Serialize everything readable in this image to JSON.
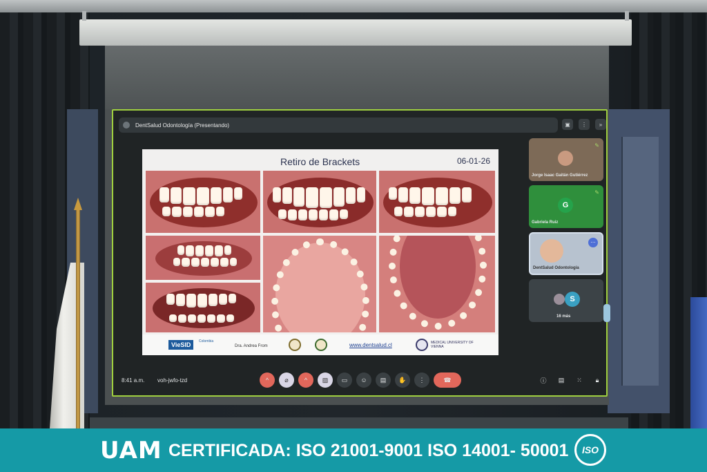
{
  "meeting": {
    "presenter_label": "DentSalud Odontología (Presentando)",
    "time": "8:41 a.m.",
    "meeting_code": "voh-jwfo-tzd",
    "participants": [
      {
        "name": "Jorge Isaac Gaitán Gutiérrez",
        "avatar": "photo"
      },
      {
        "name": "Gabriela Ruiz",
        "avatar": "G"
      },
      {
        "name": "DentSalud Odontología",
        "avatar": "photo"
      },
      {
        "name": "16 más",
        "avatar": "S"
      }
    ]
  },
  "slide": {
    "title": "Retiro de Brackets",
    "date": "06-01-26",
    "logo_viesid": "VieSID",
    "logo_viesid_sub": "Colombia",
    "author": "Dra. Andrea From",
    "website": "www.dentsalud.cl",
    "university": "MEDICAL UNIVERSITY OF VIENNA"
  },
  "banner": {
    "logo": "UAM",
    "certification": "CERTIFICADA: ISO 21001-9001   ISO 14001- 50001",
    "iso_logo": "ISO"
  },
  "icons": [
    "mic-off-icon",
    "camera-off-icon",
    "present-icon",
    "emoji-icon",
    "captions-icon",
    "hand-icon",
    "more-icon",
    "hangup-icon",
    "info-icon",
    "chat-icon",
    "apps-icon",
    "lock-icon"
  ],
  "colors": {
    "banner": "#159aa6",
    "meet_bg": "#202425",
    "hangup": "#e2675b",
    "gabriela_tile": "#2f8f3c"
  }
}
